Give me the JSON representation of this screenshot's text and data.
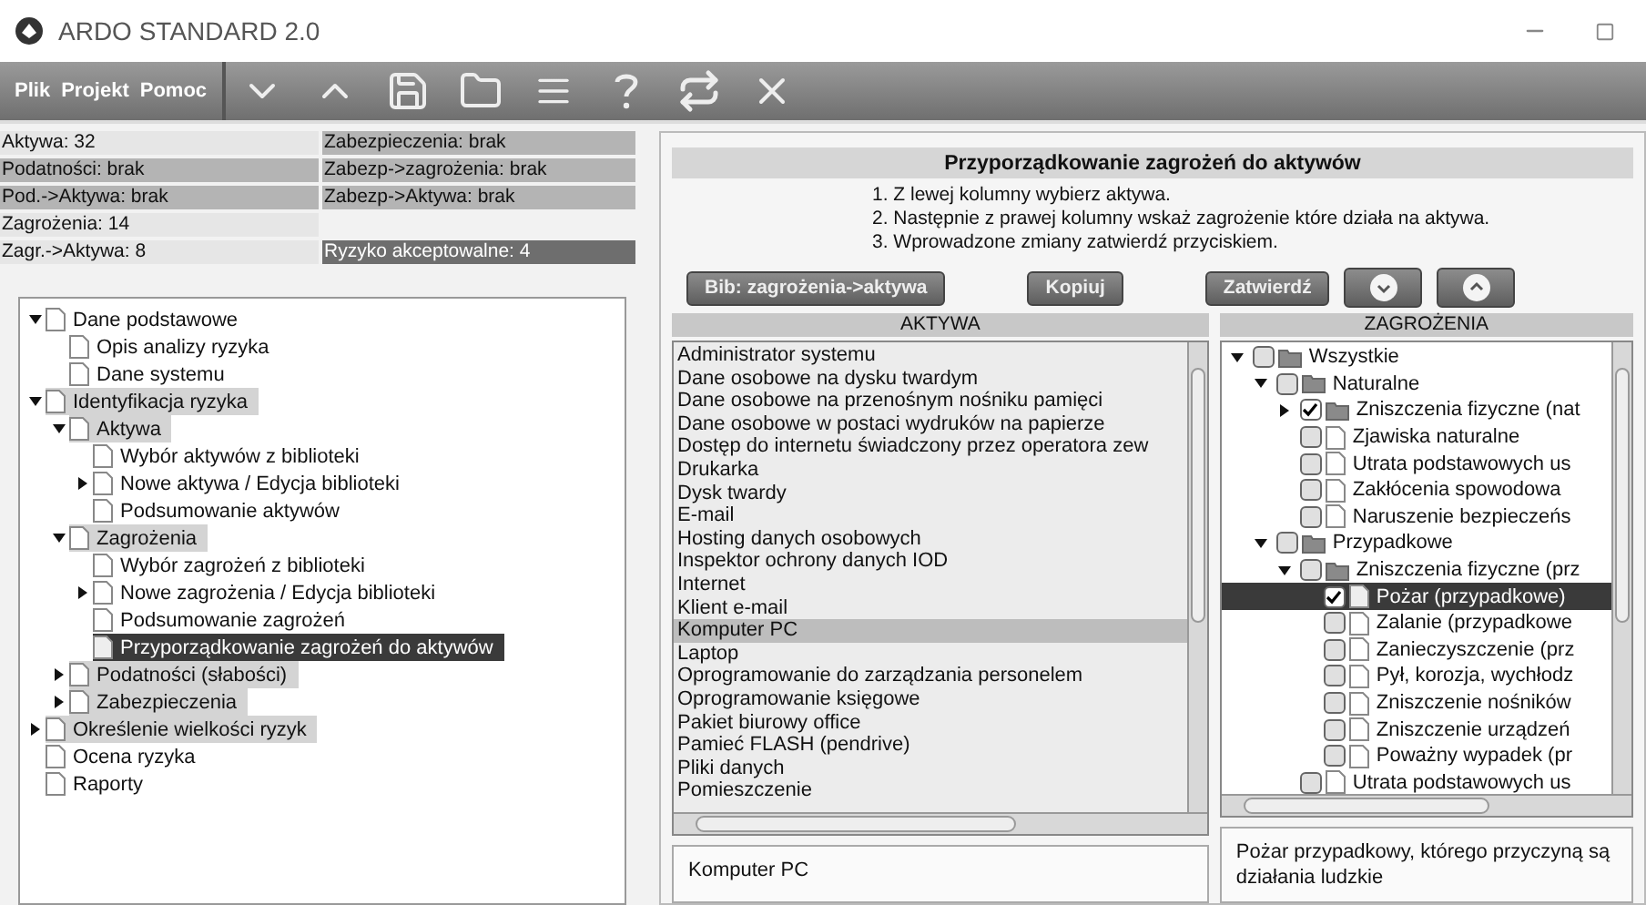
{
  "window": {
    "title": "ARDO STANDARD 2.0"
  },
  "menu": [
    "Plik",
    "Projekt",
    "Pomoc"
  ],
  "stats": [
    {
      "cells": [
        {
          "label": "Aktywa: 32",
          "color": "#e6e6e6"
        },
        {
          "label": "Zabezpieczenia: brak",
          "color": "#b4b4b4"
        }
      ]
    },
    {
      "cells": [
        {
          "label": "Podatności: brak",
          "color": "#b4b4b4"
        },
        {
          "label": "Zabezp->zagrożenia: brak",
          "color": "#b4b4b4"
        }
      ]
    },
    {
      "cells": [
        {
          "label": "Pod.->Aktywa: brak",
          "color": "#b4b4b4"
        },
        {
          "label": "Zabezp->Aktywa: brak",
          "color": "#b4b4b4"
        }
      ]
    },
    {
      "cells": [
        {
          "label": "Zagrożenia: 14",
          "color": "#e6e6e6"
        }
      ]
    },
    {
      "cells": [
        {
          "label": "Zagr.->Aktywa: 8",
          "color": "#e6e6e6"
        },
        {
          "label": "Ryzyko akceptowalne: 4",
          "color": "#6e6e6e"
        }
      ]
    }
  ],
  "nav_tree": [
    {
      "label": "Dane podstawowe",
      "expanded": true,
      "highlighted": false,
      "selected": false,
      "children": [
        {
          "label": "Opis analizy ryzyka",
          "highlighted": false,
          "selected": false
        },
        {
          "label": "Dane systemu",
          "highlighted": false,
          "selected": false
        }
      ]
    },
    {
      "label": "Identyfikacja ryzyka",
      "expanded": true,
      "highlighted": true,
      "selected": false,
      "children": [
        {
          "label": "Aktywa",
          "expanded": true,
          "highlighted": true,
          "selected": false,
          "children": [
            {
              "label": "Wybór aktywów z biblioteki",
              "highlighted": false,
              "selected": false
            },
            {
              "label": "Nowe aktywa / Edycja biblioteki",
              "expanded": false,
              "highlighted": false,
              "selected": false
            },
            {
              "label": "Podsumowanie aktywów",
              "highlighted": false,
              "selected": false
            }
          ]
        },
        {
          "label": "Zagrożenia",
          "expanded": true,
          "highlighted": true,
          "selected": false,
          "children": [
            {
              "label": "Wybór zagrożeń z biblioteki",
              "highlighted": false,
              "selected": false
            },
            {
              "label": "Nowe zagrożenia / Edycja biblioteki",
              "expanded": false,
              "highlighted": false,
              "selected": false
            },
            {
              "label": "Podsumowanie zagrożeń",
              "highlighted": false,
              "selected": false
            },
            {
              "label": "Przyporządkowanie zagrożeń do aktywów",
              "highlighted": false,
              "selected": true
            }
          ]
        },
        {
          "label": "Podatności (słabości)",
          "expanded": false,
          "highlighted": true,
          "selected": false
        },
        {
          "label": "Zabezpieczenia",
          "expanded": false,
          "highlighted": true,
          "selected": false
        }
      ]
    },
    {
      "label": "Określenie wielkości ryzyk",
      "expanded": false,
      "highlighted": true,
      "selected": false
    },
    {
      "label": "Ocena ryzyka",
      "highlighted": false,
      "selected": false
    },
    {
      "label": "Raporty",
      "highlighted": false,
      "selected": false
    }
  ],
  "panel": {
    "title": "Przyporządkowanie zagrożeń do aktywów",
    "instructions": [
      "1. Z lewej kolumny wybierz aktywa.",
      "2. Następnie z prawej kolumny wskaż zagrożenie które działa na aktywa.",
      "3. Wprowadzone zmiany zatwierdź przyciskiem."
    ],
    "buttons": [
      "Bib: zagrożenia->aktywa",
      "Kopiuj",
      "Zatwierdź"
    ]
  },
  "assets": {
    "header": "AKTYWA",
    "items": [
      {
        "label": "Administrator systemu",
        "selected": false
      },
      {
        "label": "Dane osobowe na dysku twardym",
        "selected": false
      },
      {
        "label": "Dane osobowe na przenośnym nośniku pamięci",
        "selected": false
      },
      {
        "label": "Dane osobowe w postaci wydruków na papierze",
        "selected": false
      },
      {
        "label": "Dostęp do internetu świadczony przez operatora zew",
        "selected": false
      },
      {
        "label": "Drukarka",
        "selected": false
      },
      {
        "label": "Dysk twardy",
        "selected": false
      },
      {
        "label": "E-mail",
        "selected": false
      },
      {
        "label": "Hosting danych osobowych",
        "selected": false
      },
      {
        "label": "Inspektor ochrony danych IOD",
        "selected": false
      },
      {
        "label": "Internet",
        "selected": false
      },
      {
        "label": "Klient e-mail",
        "selected": false
      },
      {
        "label": "Komputer PC",
        "selected": true
      },
      {
        "label": "Laptop",
        "selected": false
      },
      {
        "label": "Oprogramowanie do zarządzania personelem",
        "selected": false
      },
      {
        "label": "Oprogramowanie księgowe",
        "selected": false
      },
      {
        "label": "Pakiet biurowy office",
        "selected": false
      },
      {
        "label": "Pamieć FLASH (pendrive)",
        "selected": false
      },
      {
        "label": "Pliki danych",
        "selected": false
      },
      {
        "label": "Pomieszczenie",
        "selected": false
      }
    ],
    "description": "Komputer PC"
  },
  "threats": {
    "header": "ZAGROŻENIA",
    "items": [
      {
        "label": "Wszystkie",
        "kind": "folder",
        "expanded": true,
        "checked": false,
        "selected": false,
        "children": [
          {
            "label": "Naturalne",
            "kind": "folder",
            "expanded": true,
            "checked": false,
            "selected": false,
            "children": [
              {
                "label": "Zniszczenia fizyczne (nat",
                "kind": "folder",
                "expanded": false,
                "checked": true,
                "selected": false
              },
              {
                "label": "Zjawiska naturalne",
                "kind": "doc",
                "checked": false,
                "selected": false
              },
              {
                "label": "Utrata podstawowych us",
                "kind": "doc",
                "checked": false,
                "selected": false
              },
              {
                "label": "Zakłócenia spowodowa",
                "kind": "doc",
                "checked": false,
                "selected": false
              },
              {
                "label": "Naruszenie bezpieczeńs",
                "kind": "doc",
                "checked": false,
                "selected": false
              }
            ]
          },
          {
            "label": "Przypadkowe",
            "kind": "folder",
            "expanded": true,
            "checked": false,
            "selected": false,
            "children": [
              {
                "label": "Zniszczenia fizyczne (prz",
                "kind": "folder",
                "expanded": true,
                "checked": false,
                "selected": false,
                "children": [
                  {
                    "label": "Pożar (przypadkowe)",
                    "kind": "doc",
                    "checked": true,
                    "selected": true
                  },
                  {
                    "label": "Zalanie (przypadkowe",
                    "kind": "doc",
                    "checked": false,
                    "selected": false
                  },
                  {
                    "label": "Zanieczyszczenie (prz",
                    "kind": "doc",
                    "checked": false,
                    "selected": false
                  },
                  {
                    "label": "Pył, korozja, wychłodz",
                    "kind": "doc",
                    "checked": false,
                    "selected": false
                  },
                  {
                    "label": "Zniszczenie nośników",
                    "kind": "doc",
                    "checked": false,
                    "selected": false
                  },
                  {
                    "label": "Zniszczenie urządzeń",
                    "kind": "doc",
                    "checked": false,
                    "selected": false
                  },
                  {
                    "label": "Poważny wypadek (pr",
                    "kind": "doc",
                    "checked": false,
                    "selected": false
                  }
                ]
              },
              {
                "label": "Utrata podstawowych us",
                "kind": "doc",
                "checked": false,
                "selected": false
              }
            ]
          }
        ]
      }
    ],
    "description": "Pożar przypadkowy, którego przyczyną są działania ludzkie"
  }
}
